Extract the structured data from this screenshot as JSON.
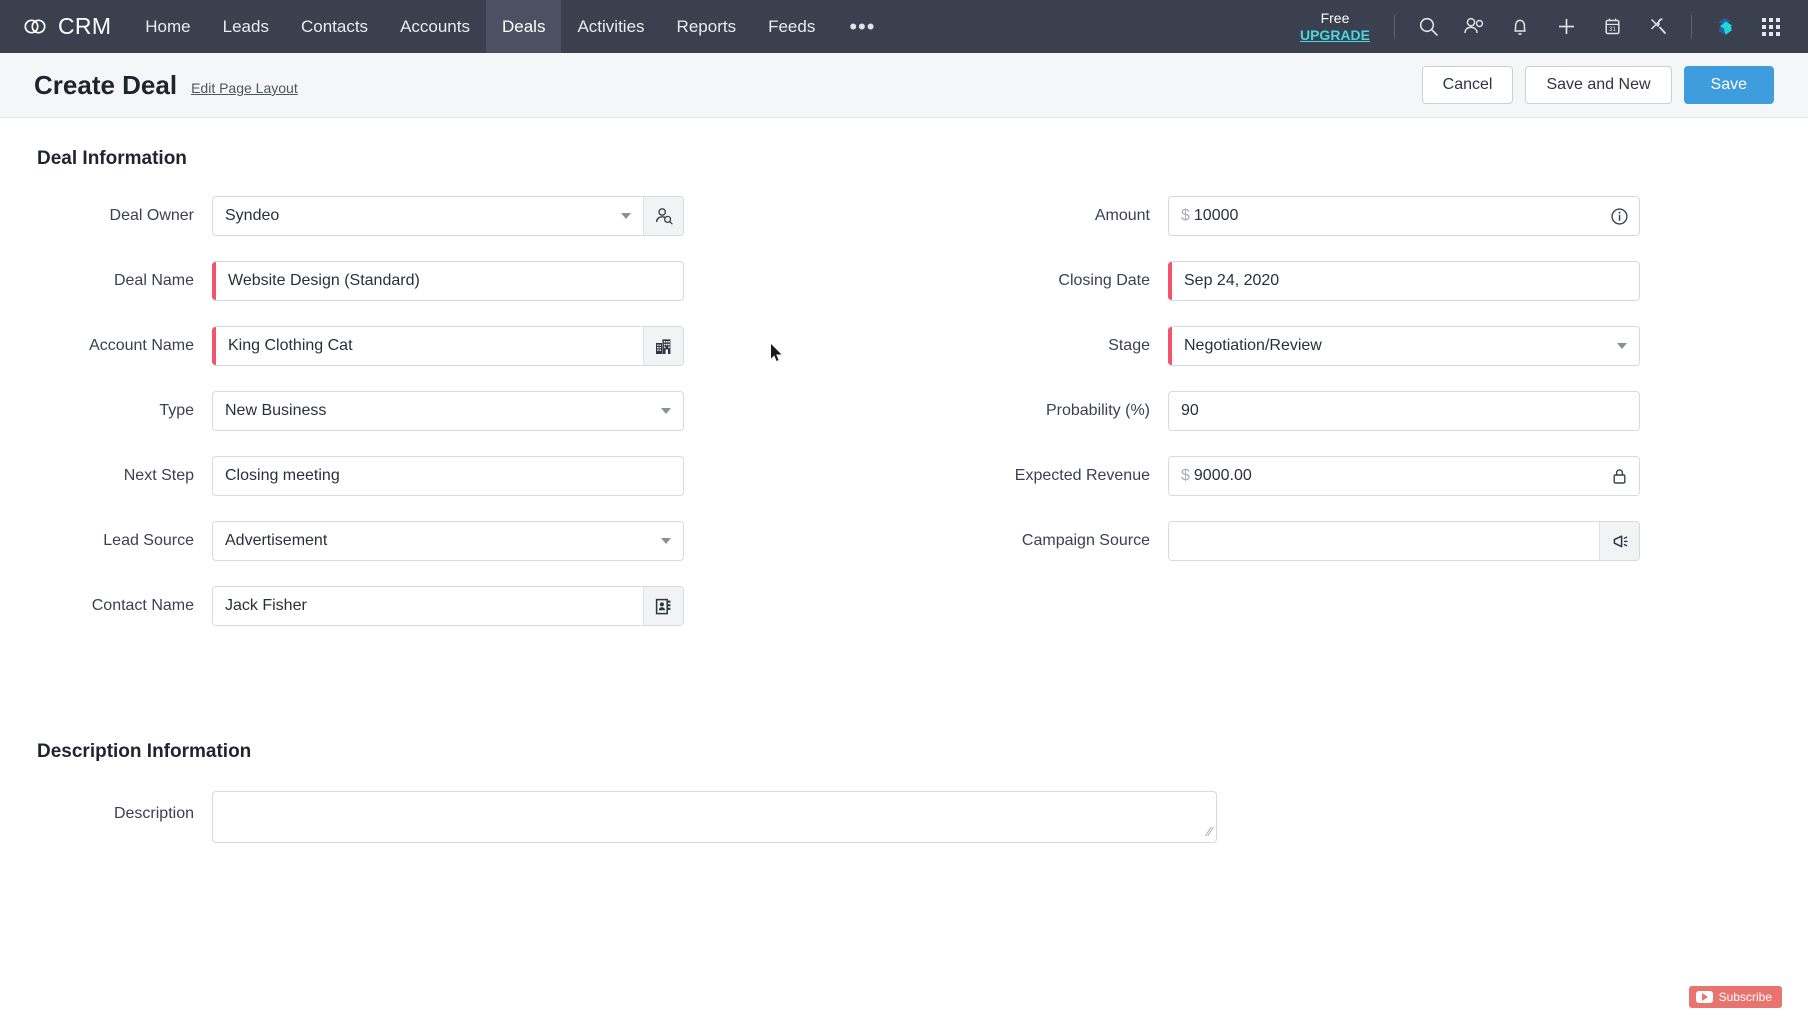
{
  "topnav": {
    "brand": "CRM",
    "brand_icon": "infinity-loop-logo",
    "tabs": [
      {
        "label": "Home",
        "active": false
      },
      {
        "label": "Leads",
        "active": false
      },
      {
        "label": "Contacts",
        "active": false
      },
      {
        "label": "Accounts",
        "active": false
      },
      {
        "label": "Deals",
        "active": true
      },
      {
        "label": "Activities",
        "active": false
      },
      {
        "label": "Reports",
        "active": false
      },
      {
        "label": "Feeds",
        "active": false
      }
    ],
    "more_label": "•••",
    "upgrade": {
      "plan": "Free",
      "action": "UPGRADE"
    },
    "icons": [
      "search-icon",
      "users-icon",
      "bell-icon",
      "plus-icon",
      "calendar-icon",
      "tools-icon",
      "zia-icon",
      "apps-grid-icon"
    ],
    "bg_color": "#3a404e",
    "active_tab_bg": "#4b5160",
    "upgrade_link_color": "#49d6e0"
  },
  "pagehead": {
    "title": "Create Deal",
    "edit_layout": "Edit Page Layout",
    "cancel": "Cancel",
    "save_and_new": "Save and New",
    "save": "Save",
    "primary_color": "#3e9ddd"
  },
  "sections": {
    "deal_information": "Deal Information",
    "description_information": "Description Information"
  },
  "fields": {
    "left": [
      {
        "label": "Deal Owner",
        "value": "Syndeo",
        "type": "lookup-select",
        "required": false,
        "caret": true,
        "addon": "user-search-icon"
      },
      {
        "label": "Deal Name",
        "value": "Website Design (Standard)",
        "type": "text",
        "required": true,
        "caret": false,
        "addon": null
      },
      {
        "label": "Account Name",
        "value": "King Clothing Cat",
        "type": "lookup",
        "required": true,
        "caret": false,
        "addon": "building-icon"
      },
      {
        "label": "Type",
        "value": "New Business",
        "type": "select",
        "required": false,
        "caret": true,
        "addon": null
      },
      {
        "label": "Next Step",
        "value": "Closing meeting",
        "type": "text",
        "required": false,
        "caret": false,
        "addon": null
      },
      {
        "label": "Lead Source",
        "value": "Advertisement",
        "type": "select",
        "required": false,
        "caret": true,
        "addon": null
      },
      {
        "label": "Contact Name",
        "value": "Jack Fisher",
        "type": "lookup",
        "required": false,
        "caret": false,
        "addon": "address-book-icon"
      }
    ],
    "right": [
      {
        "label": "Amount",
        "value": "10000",
        "currency": "$",
        "type": "currency",
        "required": false,
        "caret": false,
        "addon": "info-icon"
      },
      {
        "label": "Closing Date",
        "value": "Sep 24, 2020",
        "type": "date",
        "required": true,
        "caret": false,
        "addon": null
      },
      {
        "label": "Stage",
        "value": "Negotiation/Review",
        "type": "select",
        "required": true,
        "caret": true,
        "addon": null
      },
      {
        "label": "Probability (%)",
        "value": "90",
        "type": "number",
        "required": false,
        "caret": false,
        "addon": null
      },
      {
        "label": "Expected Revenue",
        "value": "9000.00",
        "currency": "$",
        "type": "currency-readonly",
        "required": false,
        "caret": false,
        "addon": "lock-icon"
      },
      {
        "label": "Campaign Source",
        "value": "",
        "type": "lookup",
        "required": false,
        "caret": false,
        "addon": "megaphone-icon"
      }
    ]
  },
  "description": {
    "label": "Description",
    "value": "",
    "resize_grip": "⁄⁄"
  },
  "overlay": {
    "subscribe_label": "Subscribe",
    "subscribe_color": "#e8736f"
  },
  "required_marker_color": "#f2546d"
}
